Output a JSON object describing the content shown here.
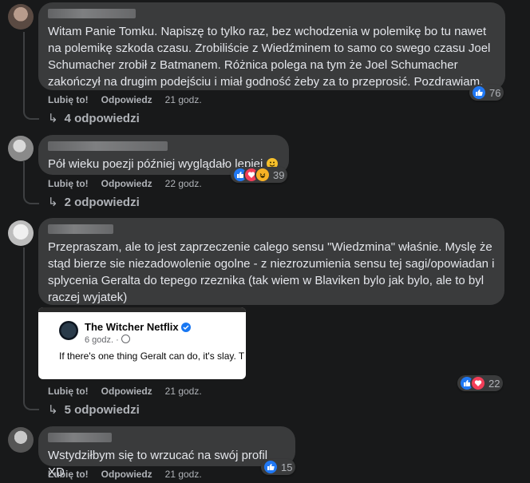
{
  "colors": {
    "background": "#18191a",
    "bubble": "#3a3b3c",
    "like": "#2078f4",
    "love": "#f33e58",
    "haha": "#f7b125"
  },
  "comments": [
    {
      "text": "Witam Panie Tomku. Napiszę to tylko raz, bez wchodzenia w polemikę bo tu nawet na polemikę szkoda czasu. Zrobiliście z Wiedźminem to samo co swego czasu Joel Schumacher zrobił z Batmanem. Różnica polega na tym że Joel Schumacher zakończył na drugim podejściu i miał godność żeby za to przeprosić. Pozdrawiam.",
      "like_label": "Lubię to!",
      "reply_label": "Odpowiedz",
      "time": "21 godz.",
      "reaction_count": "76",
      "reactions": [
        "like-icon"
      ],
      "replies_label": "4 odpowiedzi"
    },
    {
      "text": "Pół wieku poezji później wyglądało lepiej",
      "like_label": "Lubię to!",
      "reply_label": "Odpowiedz",
      "time": "22 godz.",
      "reaction_count": "39",
      "reactions": [
        "like-icon",
        "love-icon",
        "haha-icon"
      ],
      "replies_label": "2 odpowiedzi"
    },
    {
      "text": "Przepraszam, ale to jest zaprzeczenie calego sensu \"Wiedzmina\" właśnie. Myslę że stąd bierze sie niezadowolenie ogolne - z niezrozumienia sensu tej sagi/opowiadan i splycenia Geralta do tepego rzeznika (tak wiem w Blaviken bylo jak bylo, ale to byl raczej wyjatek)",
      "like_label": "Lubię to!",
      "reply_label": "Odpowiedz",
      "time": "21 godz.",
      "reaction_count": "22",
      "reactions": [
        "like-icon",
        "love-icon"
      ],
      "replies_label": "5 odpowiedzi",
      "embed": {
        "page_name": "The Witcher Netflix",
        "time": "6 godz.",
        "text": "If there's one thing Geralt can do, it's slay. T"
      }
    },
    {
      "text": "Wstydziłbym się to wrzucać na swój profil XD",
      "like_label": "Lubię to!",
      "reply_label": "Odpowiedz",
      "time": "21 godz.",
      "reaction_count": "15",
      "reactions": [
        "like-icon"
      ]
    }
  ]
}
